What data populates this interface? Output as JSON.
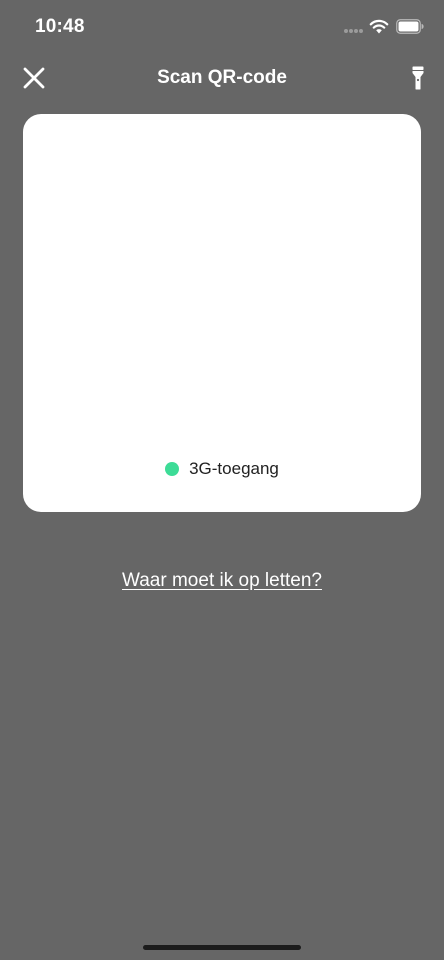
{
  "status_bar": {
    "time": "10:48",
    "icons": [
      "signal-dots-icon",
      "wifi-icon",
      "battery-icon"
    ]
  },
  "nav": {
    "close_icon": "close-icon",
    "title": "Scan QR-code",
    "flashlight_icon": "flashlight-icon"
  },
  "scanner": {
    "access_label": "3G-toegang",
    "status_color": "#3ddc97"
  },
  "help": {
    "link_label": "Waar moet ik op letten?"
  },
  "colors": {
    "background": "#666666",
    "card": "#ffffff",
    "accent_green": "#3ddc97"
  }
}
